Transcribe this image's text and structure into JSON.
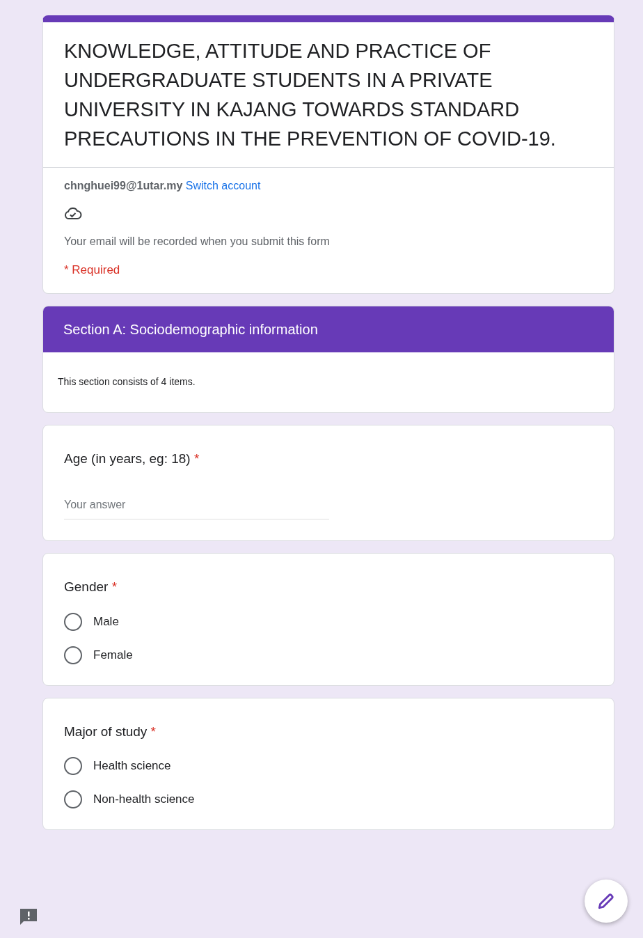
{
  "form": {
    "title": "KNOWLEDGE, ATTITUDE AND PRACTICE OF UNDERGRADUATE STUDENTS IN A PRIVATE UNIVERSITY IN KAJANG TOWARDS STANDARD PRECAUTIONS IN THE PREVENTION OF COVID-19.",
    "account": "chnghuei99@1utar.my",
    "switch_account": "Switch account",
    "email_notice": "Your email will be recorded when you submit this form",
    "required_note": "* Required"
  },
  "section": {
    "title": "Section A: Sociodemographic information",
    "description": "This section consists of 4 items."
  },
  "questions": [
    {
      "kind": "text",
      "label": "Age (in years, eg: 18)",
      "required_mark": "*",
      "placeholder": "Your answer"
    },
    {
      "kind": "radio",
      "label": "Gender",
      "required_mark": "*",
      "options": [
        {
          "label": "Male",
          "selected": false
        },
        {
          "label": "Female",
          "selected": false
        }
      ]
    },
    {
      "kind": "radio",
      "label": "Major of study",
      "required_mark": "*",
      "options": [
        {
          "label": "Health science",
          "selected": false
        },
        {
          "label": "Non-health science",
          "selected": false
        }
      ]
    }
  ]
}
